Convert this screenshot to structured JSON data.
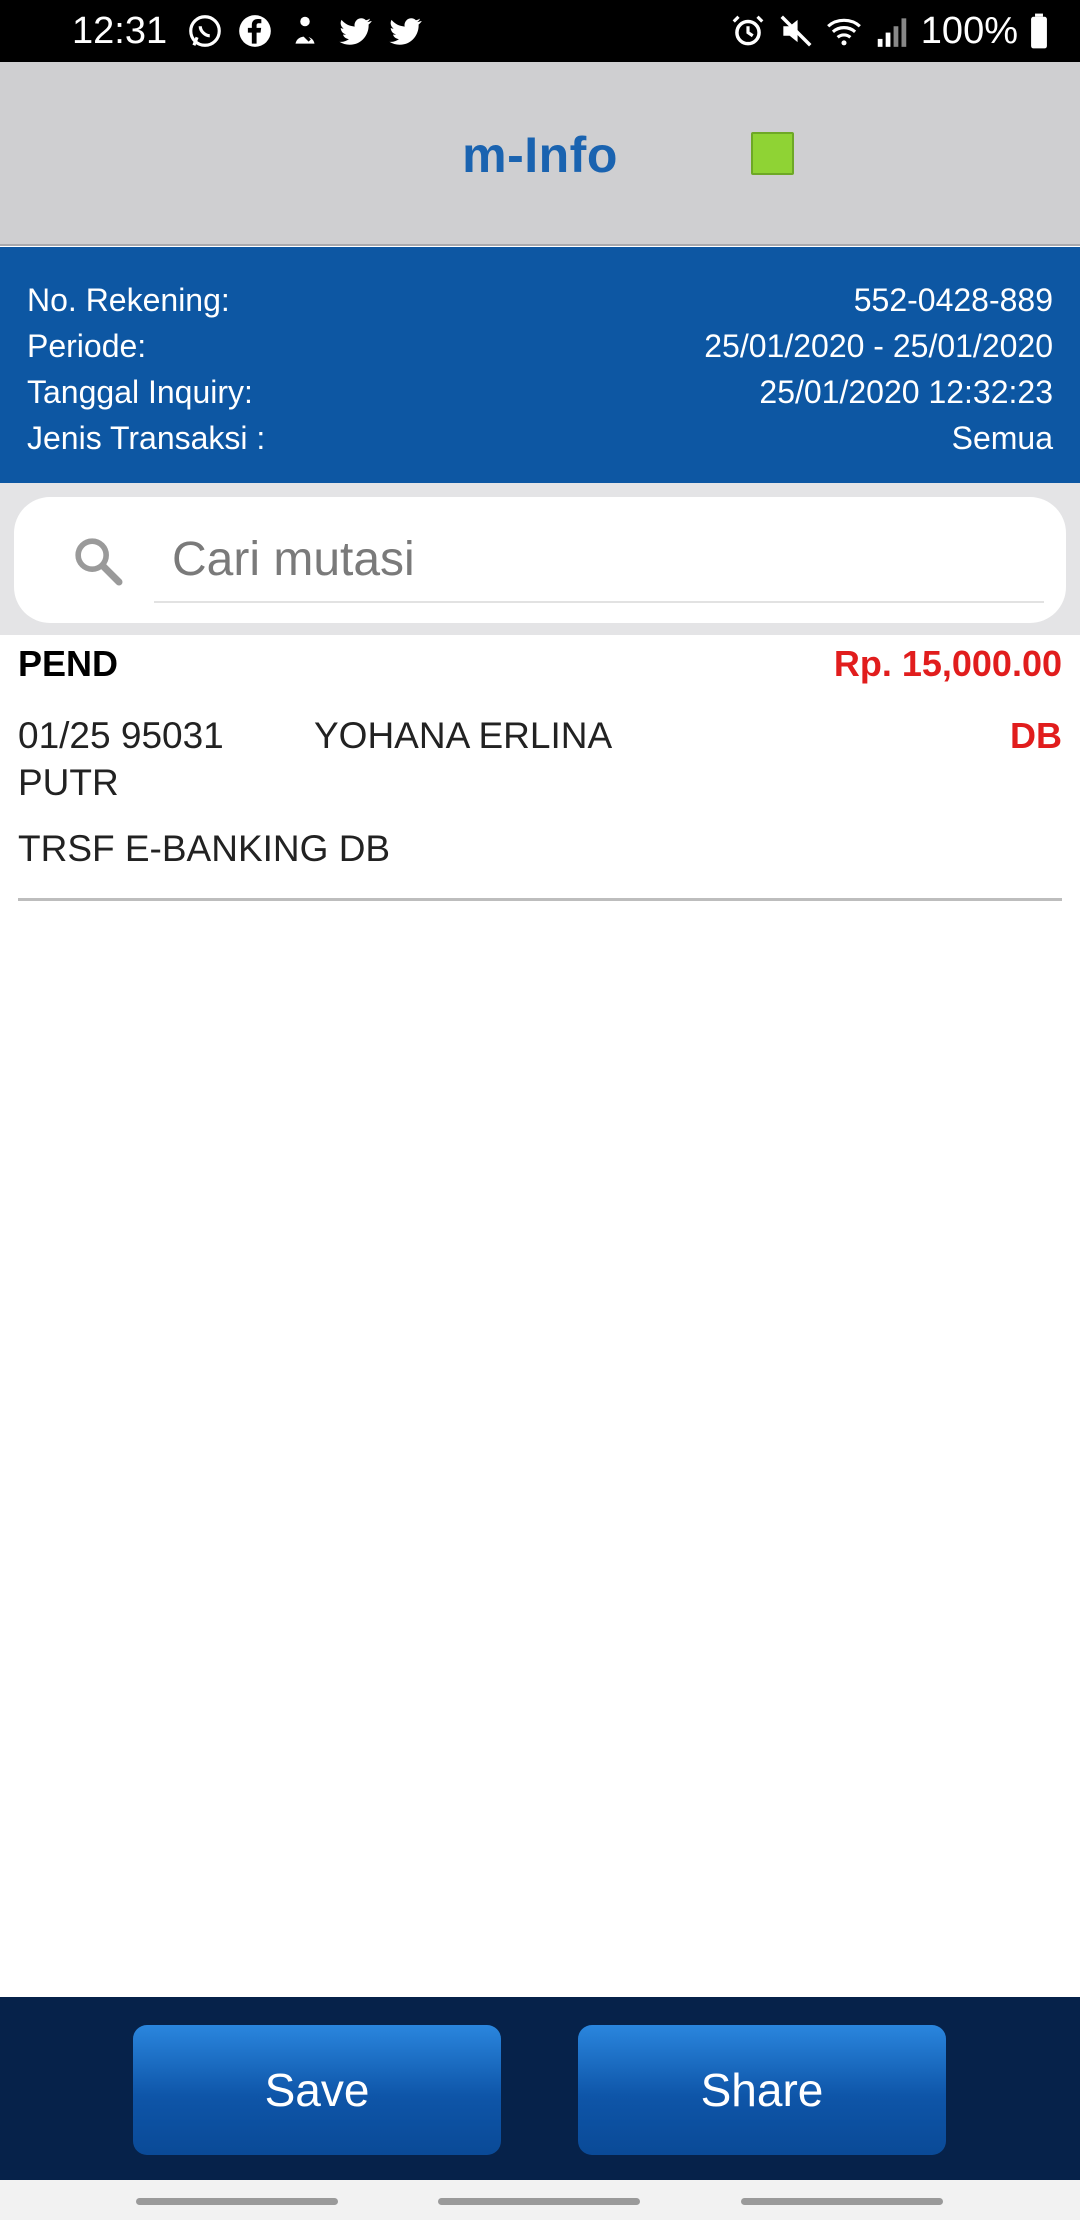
{
  "status_bar": {
    "time": "12:31",
    "left_icons": [
      "whatsapp-icon",
      "facebook-icon",
      "notification-icon",
      "twitter-icon",
      "twitter-icon"
    ],
    "right_icons": [
      "alarm-icon",
      "mute-icon",
      "wifi-icon",
      "signal-icon"
    ],
    "battery_text": "100%"
  },
  "header": {
    "title": "m-Info",
    "indicator_color": "#8fd334"
  },
  "account_info": {
    "rows": [
      {
        "label": "No. Rekening:",
        "value": "552-0428-889"
      },
      {
        "label": "Periode:",
        "value": "25/01/2020 - 25/01/2020"
      },
      {
        "label": "Tanggal Inquiry:",
        "value": "25/01/2020 12:32:23"
      },
      {
        "label": "Jenis Transaksi :",
        "value": "Semua"
      }
    ]
  },
  "search": {
    "placeholder": "Cari mutasi",
    "value": ""
  },
  "transactions": [
    {
      "status": "PEND",
      "amount": "Rp. 15,000.00",
      "line1": "01/25 95031",
      "name": "YOHANA ERLINA",
      "type": "DB",
      "line2": "PUTR",
      "description": "TRSF E-BANKING DB"
    }
  ],
  "actions": {
    "save_label": "Save",
    "share_label": "Share"
  },
  "colors": {
    "brand_blue": "#0d57a3",
    "debit_red": "#e11d1d",
    "title_blue": "#1a63b0"
  }
}
